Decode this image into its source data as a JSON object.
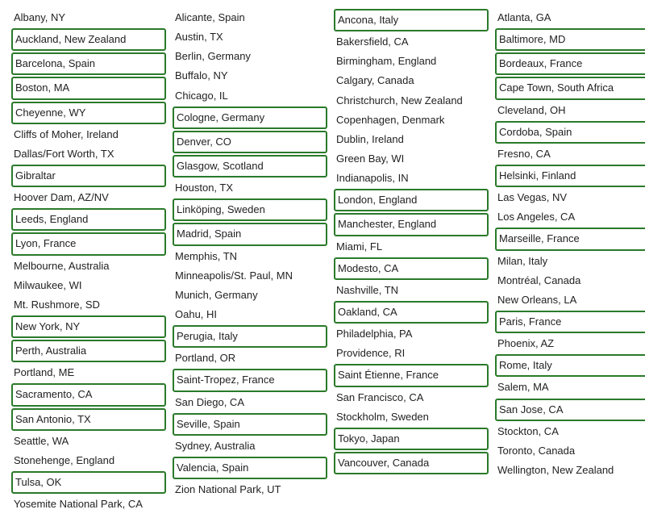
{
  "columns": [
    {
      "id": "col1",
      "items": [
        {
          "label": "Albany, NY",
          "boxed": false
        },
        {
          "label": "Auckland, New Zealand",
          "boxed": true
        },
        {
          "label": "Barcelona, Spain",
          "boxed": true
        },
        {
          "label": "Boston, MA",
          "boxed": true
        },
        {
          "label": "Cheyenne, WY",
          "boxed": true
        },
        {
          "label": "Cliffs of Moher, Ireland",
          "boxed": false
        },
        {
          "label": "Dallas/Fort Worth, TX",
          "boxed": false
        },
        {
          "label": "Gibraltar",
          "boxed": true
        },
        {
          "label": "Hoover Dam, AZ/NV",
          "boxed": false
        },
        {
          "label": "Leeds, England",
          "boxed": true
        },
        {
          "label": "Lyon, France",
          "boxed": true
        },
        {
          "label": "Melbourne, Australia",
          "boxed": false
        },
        {
          "label": "Milwaukee, WI",
          "boxed": false
        },
        {
          "label": "Mt. Rushmore, SD",
          "boxed": false
        },
        {
          "label": "New York, NY",
          "boxed": true
        },
        {
          "label": "Perth, Australia",
          "boxed": true
        },
        {
          "label": "Portland, ME",
          "boxed": false
        },
        {
          "label": "Sacramento, CA",
          "boxed": true
        },
        {
          "label": "San Antonio, TX",
          "boxed": true
        },
        {
          "label": "Seattle, WA",
          "boxed": false
        },
        {
          "label": "Stonehenge, England",
          "boxed": false
        },
        {
          "label": "Tulsa, OK",
          "boxed": true
        },
        {
          "label": "Yosemite National Park, CA",
          "boxed": false
        }
      ]
    },
    {
      "id": "col2",
      "items": [
        {
          "label": "Alicante, Spain",
          "boxed": false
        },
        {
          "label": "Austin, TX",
          "boxed": false
        },
        {
          "label": "Berlin, Germany",
          "boxed": false
        },
        {
          "label": "Buffalo, NY",
          "boxed": false
        },
        {
          "label": "Chicago, IL",
          "boxed": false
        },
        {
          "label": "Cologne, Germany",
          "boxed": true
        },
        {
          "label": "Denver, CO",
          "boxed": true
        },
        {
          "label": "Glasgow, Scotland",
          "boxed": true
        },
        {
          "label": "Houston, TX",
          "boxed": false
        },
        {
          "label": "Linköping, Sweden",
          "boxed": true
        },
        {
          "label": "Madrid, Spain",
          "boxed": true
        },
        {
          "label": "Memphis, TN",
          "boxed": false
        },
        {
          "label": "Minneapolis/St. Paul, MN",
          "boxed": false
        },
        {
          "label": "Munich, Germany",
          "boxed": false
        },
        {
          "label": "Oahu, HI",
          "boxed": false
        },
        {
          "label": "Perugia, Italy",
          "boxed": true
        },
        {
          "label": "Portland, OR",
          "boxed": false
        },
        {
          "label": "Saint-Tropez, France",
          "boxed": true
        },
        {
          "label": "San Diego, CA",
          "boxed": false
        },
        {
          "label": "Seville, Spain",
          "boxed": true
        },
        {
          "label": "Sydney, Australia",
          "boxed": false
        },
        {
          "label": "Valencia, Spain",
          "boxed": true
        },
        {
          "label": "Zion National Park, UT",
          "boxed": false
        }
      ]
    },
    {
      "id": "col3",
      "items": [
        {
          "label": "Ancona, Italy",
          "boxed": true
        },
        {
          "label": "Bakersfield, CA",
          "boxed": false
        },
        {
          "label": "Birmingham, England",
          "boxed": false
        },
        {
          "label": "Calgary, Canada",
          "boxed": false
        },
        {
          "label": "Christchurch, New Zealand",
          "boxed": false
        },
        {
          "label": "Copenhagen, Denmark",
          "boxed": false
        },
        {
          "label": "Dublin, Ireland",
          "boxed": false
        },
        {
          "label": "Green Bay, WI",
          "boxed": false
        },
        {
          "label": "Indianapolis, IN",
          "boxed": false
        },
        {
          "label": "London, England",
          "boxed": true
        },
        {
          "label": "Manchester, England",
          "boxed": true
        },
        {
          "label": "Miami, FL",
          "boxed": false
        },
        {
          "label": "Modesto, CA",
          "boxed": true
        },
        {
          "label": "Nashville, TN",
          "boxed": false
        },
        {
          "label": "Oakland, CA",
          "boxed": true
        },
        {
          "label": "Philadelphia, PA",
          "boxed": false
        },
        {
          "label": "Providence, RI",
          "boxed": false
        },
        {
          "label": "Saint Étienne, France",
          "boxed": true
        },
        {
          "label": "San Francisco, CA",
          "boxed": false
        },
        {
          "label": "Stockholm, Sweden",
          "boxed": false
        },
        {
          "label": "Tokyo, Japan",
          "boxed": true
        },
        {
          "label": "Vancouver, Canada",
          "boxed": true
        }
      ]
    },
    {
      "id": "col4",
      "items": [
        {
          "label": "Atlanta, GA",
          "boxed": false
        },
        {
          "label": "Baltimore, MD",
          "boxed": true
        },
        {
          "label": "Bordeaux, France",
          "boxed": true
        },
        {
          "label": "Cape Town, South Africa",
          "boxed": true
        },
        {
          "label": "Cleveland, OH",
          "boxed": false
        },
        {
          "label": "Cordoba, Spain",
          "boxed": true
        },
        {
          "label": "Fresno, CA",
          "boxed": false
        },
        {
          "label": "Helsinki, Finland",
          "boxed": true
        },
        {
          "label": "Las Vegas, NV",
          "boxed": false
        },
        {
          "label": "Los Angeles, CA",
          "boxed": false
        },
        {
          "label": "Marseille, France",
          "boxed": true
        },
        {
          "label": "Milan, Italy",
          "boxed": false
        },
        {
          "label": "Montréal, Canada",
          "boxed": false
        },
        {
          "label": "New Orleans, LA",
          "boxed": false
        },
        {
          "label": "Paris, France",
          "boxed": true
        },
        {
          "label": "Phoenix, AZ",
          "boxed": false
        },
        {
          "label": "Rome, Italy",
          "boxed": true
        },
        {
          "label": "Salem, MA",
          "boxed": false
        },
        {
          "label": "San Jose, CA",
          "boxed": true
        },
        {
          "label": "Stockton, CA",
          "boxed": false
        },
        {
          "label": "Toronto, Canada",
          "boxed": false
        },
        {
          "label": "Wellington, New Zealand",
          "boxed": false
        }
      ]
    }
  ]
}
